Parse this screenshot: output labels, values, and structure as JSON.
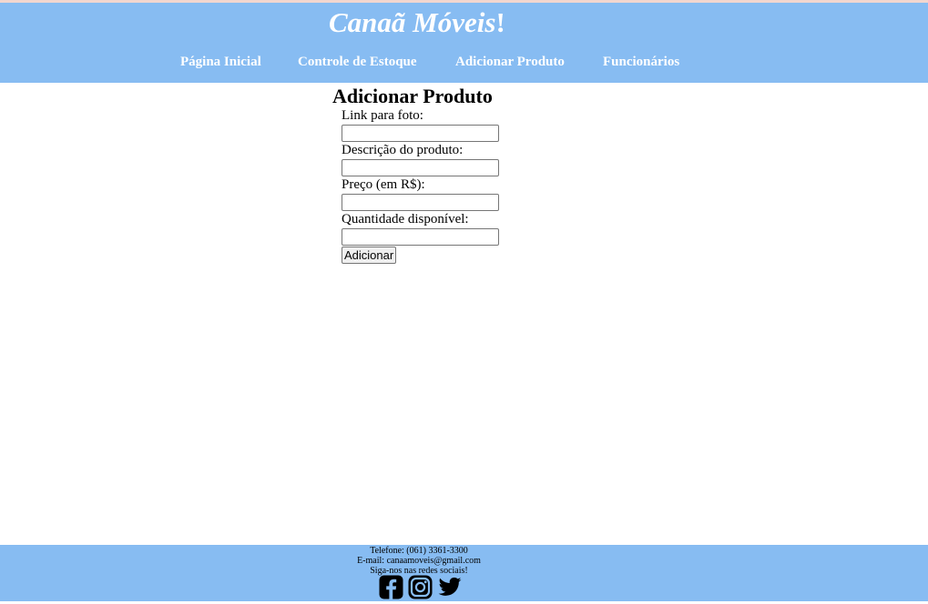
{
  "header": {
    "brand_name": "Canaã Móveis",
    "brand_suffix": "!",
    "background_color": "#87bcf2",
    "nav": [
      {
        "label": "Página Inicial"
      },
      {
        "label": "Controle de Estoque"
      },
      {
        "label": "Adicionar Produto"
      },
      {
        "label": "Funcionários"
      }
    ]
  },
  "main": {
    "title": "Adicionar Produto",
    "fields": [
      {
        "label": "Link para foto:",
        "value": "",
        "placeholder": ""
      },
      {
        "label": "Descrição do produto:",
        "value": "",
        "placeholder": ""
      },
      {
        "label": "Preço (em R$):",
        "value": "",
        "placeholder": ""
      },
      {
        "label": "Quantidade disponível:",
        "value": "",
        "placeholder": ""
      }
    ],
    "submit_label": "Adicionar"
  },
  "footer": {
    "phone": "Telefone: (061) 3361-3300",
    "email": "E-mail: canaamoveis@gmail.com",
    "social_text": "Siga-nos nas redes sociais!",
    "social_icons": [
      "facebook-icon",
      "instagram-icon",
      "twitter-icon"
    ]
  }
}
